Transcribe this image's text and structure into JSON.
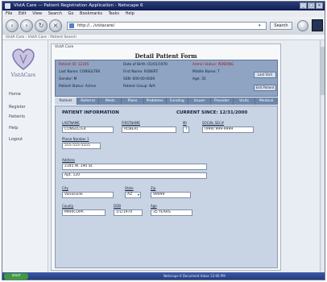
{
  "window": {
    "title": "VistA Care — Patient Registration Application - Netscape 6",
    "buttons": [
      "_",
      "□",
      "×"
    ]
  },
  "menubar": {
    "items": [
      "File",
      "Edit",
      "View",
      "Search",
      "Go",
      "Bookmarks",
      "Tasks",
      "Help"
    ]
  },
  "toolbar": {
    "url": "http://.../vistacare/",
    "search_label": "Search"
  },
  "statusline": {
    "text": "VistA Care  :  VistA Care  :  Patient Search"
  },
  "sidebar": {
    "logo_text": "VistACare",
    "items": [
      "Home",
      "Register",
      "Patients",
      "Help",
      "Logout"
    ]
  },
  "main": {
    "header": "VistA Care",
    "title": "Detail Patient Form",
    "info": {
      "patient_id_label": "Patient ID: 12345",
      "last_name_label": "Last Name: CONSULTER",
      "gender_label": "Gender: M",
      "patient_status_label": "Patient Status: Active",
      "date_of_birth_label": "Date of Birth: 01/01/1970",
      "first_name_label": "First Name: ROBERT",
      "ssn_label": "SSN: 000-00-0000",
      "patient_group_label": "Patient Group: N/A",
      "admin_status_label": "Admin Status: PENDING",
      "middle_name_label": "Middle Name: T",
      "age_label": "Age: 35",
      "btn1": "Last Visit",
      "btn2": "Edit Patient"
    },
    "tabs": [
      "Patient",
      "Referral",
      "Meds",
      "Plans",
      "Problems",
      "Funding",
      "Issues",
      "Provider",
      "Visits",
      "Medical"
    ],
    "active_tab": 0,
    "form": {
      "section_title": "PATIENT INFORMATION",
      "current_since": "CURRENT SINCE: 12/31/2000",
      "lastname_label": "LASTNAME",
      "lastname_value": "CONSULTER",
      "firstname_label": "FIRSTNAME",
      "firstname_value": "ROBERT",
      "mi_label": "MI",
      "mi_value": "T",
      "ssn_label": "SOCIAL SEC#",
      "ssn_value": "(999) 999-9999",
      "phone_label": "Phone Number 1",
      "phone_value": "555-555-5555",
      "address_label": "Address",
      "address1_value": "2345 W. 190 St.",
      "address2_value": "Apt. 120",
      "city_label": "City",
      "city_value": "Vanasville",
      "state_label": "State",
      "state_value": "AZ",
      "zip_label": "Zip",
      "zip_value": "99999",
      "county_label": "County",
      "county_value": "MARICOPA",
      "dob_label": "DOB",
      "dob_value": "1/1/1970",
      "age_label": "Age",
      "age_value": "35 YEARS"
    }
  },
  "taskbar": {
    "start": "start",
    "items": "Netscape 6   Document   Inbox   12:00 PM"
  },
  "colors": {
    "infobox": "#8ea4c2",
    "tabbar": "#6f87ab",
    "form": "#c8d3e3",
    "taskbar": "#23397a"
  }
}
